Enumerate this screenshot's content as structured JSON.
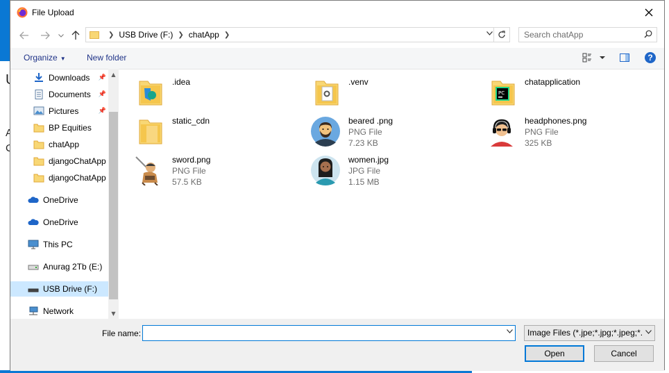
{
  "window": {
    "title": "File Upload"
  },
  "address": {
    "segments": [
      "USB Drive (F:)",
      "chatApp"
    ]
  },
  "search": {
    "placeholder": "Search chatApp"
  },
  "toolbar": {
    "organize_label": "Organize",
    "new_folder_label": "New folder",
    "help_label": "?"
  },
  "sidebar": {
    "items": [
      {
        "label": "Downloads",
        "icon": "download-icon",
        "pinned": true
      },
      {
        "label": "Documents",
        "icon": "documents-icon",
        "pinned": true
      },
      {
        "label": "Pictures",
        "icon": "pictures-icon",
        "pinned": true
      },
      {
        "label": "BP Equities",
        "icon": "folder-icon"
      },
      {
        "label": "chatApp",
        "icon": "folder-icon"
      },
      {
        "label": "djangoChatApp",
        "icon": "folder-icon"
      },
      {
        "label": "djangoChatApp",
        "icon": "folder-icon"
      },
      {
        "label": "OneDrive",
        "icon": "cloud-icon"
      },
      {
        "label": "OneDrive",
        "icon": "cloud-icon"
      },
      {
        "label": "This PC",
        "icon": "computer-icon"
      },
      {
        "label": "Anurag 2Tb (E:)",
        "icon": "drive-icon"
      },
      {
        "label": "USB Drive (F:)",
        "icon": "usb-drive-icon",
        "selected": true
      },
      {
        "label": "Network",
        "icon": "network-icon"
      }
    ]
  },
  "files": [
    {
      "name": ".idea",
      "type": "",
      "size": "",
      "icon": "folder-icon"
    },
    {
      "name": ".venv",
      "type": "",
      "size": "",
      "icon": "folder-gear-icon"
    },
    {
      "name": "chatapplication",
      "type": "",
      "size": "",
      "icon": "pycharm-folder-icon"
    },
    {
      "name": "static_cdn",
      "type": "",
      "size": "",
      "icon": "folder-icon"
    },
    {
      "name": "beared .png",
      "type": "PNG File",
      "size": "7.23 KB",
      "icon": "bearded-man-avatar"
    },
    {
      "name": "headphones.png",
      "type": "PNG File",
      "size": "325 KB",
      "icon": "headphones-avatar"
    },
    {
      "name": "sword.png",
      "type": "PNG File",
      "size": "57.5 KB",
      "icon": "sword-character-image"
    },
    {
      "name": "women.jpg",
      "type": "JPG File",
      "size": "1.15 MB",
      "icon": "woman-avatar"
    }
  ],
  "bottom": {
    "file_name_label": "File name:",
    "file_name_value": "",
    "filter_label": "Image Files (*.jpe;*.jpg;*.jpeg;*.",
    "open_label": "Open",
    "cancel_label": "Cancel"
  },
  "backdrop": {
    "char1": "U",
    "char2": "A",
    "char3": "C"
  },
  "colors": {
    "accent": "#0078d7",
    "selected": "#cce8ff",
    "desktop": "#0a78d4"
  }
}
